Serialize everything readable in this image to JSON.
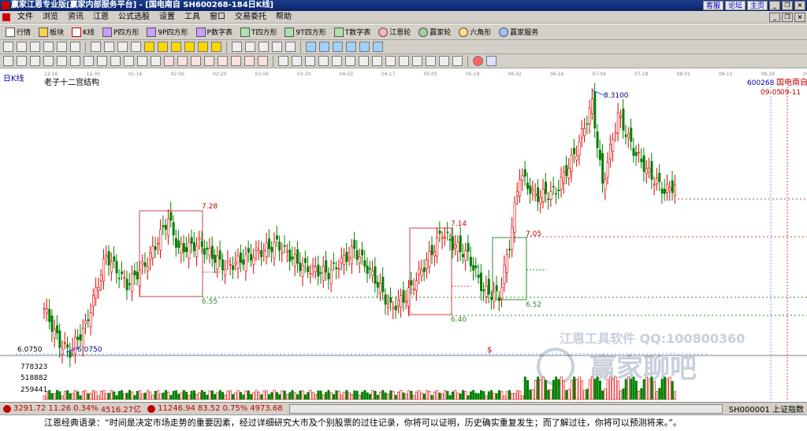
{
  "window": {
    "title": "赢家江恩专业版[赢家内部服务平台] - [国电南自  SH600268-184日K线]",
    "links": [
      "客服",
      "论坛",
      "主页"
    ]
  },
  "menu": [
    "文件",
    "浏览",
    "资讯",
    "江恩",
    "公式选股",
    "设置",
    "工具",
    "窗口",
    "交易委托",
    "帮助"
  ],
  "toolbar1": [
    {
      "label": "行情",
      "icon": "grid-icon"
    },
    {
      "label": "板块",
      "icon": "blocks-icon"
    },
    {
      "label": "K线",
      "icon": "kline-icon"
    },
    {
      "label": "P四方形",
      "icon": "p-square-icon"
    },
    {
      "label": "9P四方形",
      "icon": "9p-square-icon"
    },
    {
      "label": "P数字表",
      "icon": "p-number-table-icon"
    },
    {
      "label": "T四方形",
      "icon": "t-square-icon"
    },
    {
      "label": "9T四方形",
      "icon": "9t-square-icon"
    },
    {
      "label": "T数字表",
      "icon": "t-number-table-icon"
    },
    {
      "label": "江恩轮",
      "icon": "gann-wheel-icon"
    },
    {
      "label": "赢家轮",
      "icon": "winner-wheel-icon"
    },
    {
      "label": "六角形",
      "icon": "hexagon-icon"
    },
    {
      "label": "赢家服务",
      "icon": "service-icon"
    }
  ],
  "chart": {
    "period_label": "日K线",
    "study_label": "老子十二宫结构",
    "code": "600268",
    "name": "国电南自",
    "date_markers": [
      "09-05",
      "09-11"
    ],
    "price_labels": [
      "7.28",
      "6.55",
      "7.14",
      "6.40",
      "7.05",
      "6.52",
      "8.3100",
      "6.0750"
    ],
    "left_price": "6.0750",
    "volume_ticks": [
      "778323",
      "518882",
      "259441"
    ],
    "x_dates": [
      "12-16",
      "12-30",
      "01-16",
      "02-06",
      "02-20",
      "03-06",
      "03-20",
      "04-03",
      "04-17",
      "05-05",
      "05-19",
      "06-02",
      "06-16",
      "07-04",
      "07-18",
      "08-01",
      "08-15",
      "08-29",
      "09-12"
    ],
    "watermark1": "江恩工具软件  QQ:100800360",
    "watermark2": "赢家聊吧",
    "dollar_mark": "$",
    "colors": {
      "up": "#e00000",
      "down": "#008000",
      "box_red": "#d04040",
      "box_green": "#2e8b2e"
    }
  },
  "chart_data": {
    "type": "candlestick",
    "symbol": "SH600268",
    "name": "国电南自",
    "x": [
      "12-16",
      "12-30",
      "01-16",
      "02-06",
      "02-20",
      "03-06",
      "03-20",
      "04-03",
      "04-17",
      "05-05",
      "05-19",
      "06-02",
      "06-16",
      "07-04",
      "07-18",
      "08-01",
      "08-15",
      "08-29",
      "09-12"
    ],
    "anchor_prices": [
      {
        "x": "12-30",
        "y": 6.075
      },
      {
        "x": "02-20",
        "y": 7.28
      },
      {
        "x": "02-20",
        "y": 6.55
      },
      {
        "x": "05-19",
        "y": 7.14
      },
      {
        "x": "05-19",
        "y": 6.4
      },
      {
        "x": "06-16",
        "y": 7.05
      },
      {
        "x": "06-16",
        "y": 6.52
      },
      {
        "x": "07-18",
        "y": 8.31
      }
    ],
    "volume_ticks": [
      259441,
      518882,
      778323
    ]
  },
  "status": {
    "idx1": "3291.72",
    "idx1_chg": "11.26",
    "idx1_pct": "0.34%",
    "idx1_amt": "4516.27亿",
    "idx2": "11246.94",
    "idx2_chg": "83.52",
    "idx2_pct": "0.75%",
    "idx2_amt": "4973.68",
    "right": "SH000001 上证指数"
  },
  "quote": "江恩经典语录：“时间是决定市场走势的重要因素，经过详细研究大市及个别股票的过往记录，你将可以证明，历史确实重复发生；而了解过往，你将可以预测将来。”。"
}
